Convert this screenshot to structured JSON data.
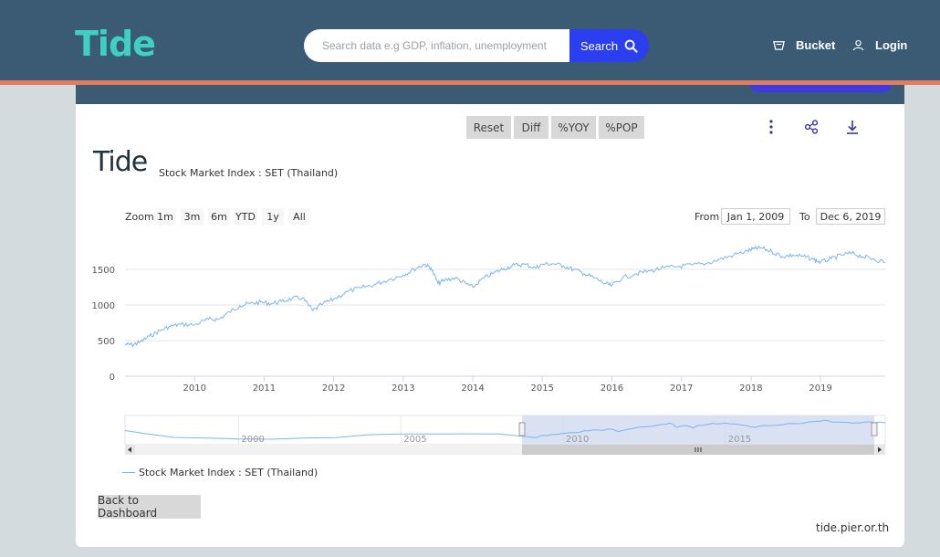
{
  "header": {
    "logo": "Tide",
    "search_placeholder": "Search data e.g GDP, inflation, unemployment",
    "search_button": "Search",
    "bucket_label": "Bucket",
    "login_label": "Login"
  },
  "toolbar": {
    "reset": "Reset",
    "diff": "Diff",
    "yoy": "%YOY",
    "pop": "%POP"
  },
  "brand_logo": "Tide",
  "title": "Stock Market Index : SET (Thailand)",
  "range_selector": {
    "zoom_label": "Zoom",
    "buttons": [
      "1m",
      "3m",
      "6m",
      "YTD",
      "1y",
      "All"
    ],
    "from_label": "From",
    "from_value": "Jan 1, 2009",
    "to_label": "To",
    "to_value": "Dec 6, 2019"
  },
  "colors": {
    "series": "#7cb5ec",
    "header_bg": "#3b5a73",
    "accent_orange": "#e27c5f",
    "search_button": "#2b3ff0",
    "navigator_mask": "#d2dcf0"
  },
  "chart_data": {
    "type": "line",
    "title": "Stock Market Index : SET (Thailand)",
    "xlabel": "",
    "ylabel": "",
    "x_ticks": [
      "2010",
      "2011",
      "2012",
      "2013",
      "2014",
      "2015",
      "2016",
      "2017",
      "2018",
      "2019"
    ],
    "y_ticks": [
      0,
      500,
      1000,
      1500
    ],
    "xlim": [
      2009.0,
      2019.93
    ],
    "ylim": [
      0,
      2000
    ],
    "grid": true,
    "legend_position": "bottom-left",
    "series": [
      {
        "name": "Stock Market Index : SET (Thailand)",
        "x": [
          2009.0,
          2009.1,
          2009.2,
          2009.35,
          2009.5,
          2009.65,
          2009.8,
          2010.0,
          2010.2,
          2010.35,
          2010.5,
          2010.65,
          2010.8,
          2010.95,
          2011.1,
          2011.25,
          2011.4,
          2011.55,
          2011.7,
          2011.85,
          2012.0,
          2012.2,
          2012.4,
          2012.6,
          2012.8,
          2013.0,
          2013.15,
          2013.3,
          2013.4,
          2013.5,
          2013.6,
          2013.75,
          2013.9,
          2014.0,
          2014.15,
          2014.3,
          2014.45,
          2014.6,
          2014.75,
          2014.9,
          2015.0,
          2015.15,
          2015.3,
          2015.45,
          2015.6,
          2015.75,
          2015.9,
          2016.0,
          2016.15,
          2016.35,
          2016.55,
          2016.75,
          2016.95,
          2017.15,
          2017.35,
          2017.55,
          2017.75,
          2017.95,
          2018.05,
          2018.15,
          2018.3,
          2018.45,
          2018.6,
          2018.75,
          2018.9,
          2019.0,
          2019.15,
          2019.3,
          2019.45,
          2019.6,
          2019.75,
          2019.93
        ],
        "values": [
          450,
          440,
          470,
          560,
          640,
          700,
          730,
          720,
          800,
          800,
          900,
          990,
          1020,
          1040,
          1020,
          1050,
          1090,
          1100,
          920,
          1020,
          1080,
          1190,
          1240,
          1290,
          1360,
          1420,
          1500,
          1570,
          1520,
          1300,
          1350,
          1380,
          1300,
          1250,
          1370,
          1450,
          1510,
          1560,
          1570,
          1520,
          1570,
          1580,
          1550,
          1500,
          1440,
          1380,
          1300,
          1270,
          1380,
          1440,
          1480,
          1520,
          1540,
          1560,
          1580,
          1640,
          1700,
          1760,
          1790,
          1800,
          1750,
          1680,
          1700,
          1680,
          1640,
          1600,
          1650,
          1700,
          1730,
          1680,
          1650,
          1600
        ]
      }
    ],
    "navigator": {
      "x_ticks": [
        "2000",
        "2005",
        "2010",
        "2015"
      ],
      "selected_range": [
        "Jan 1, 2009",
        "Dec 6, 2019"
      ]
    }
  },
  "footer": {
    "back_button": "Back to Dashboard",
    "site_url": "tide.pier.or.th"
  }
}
